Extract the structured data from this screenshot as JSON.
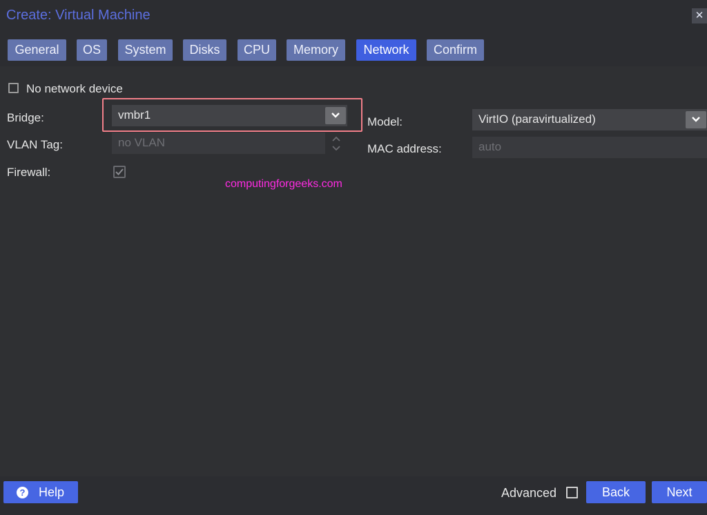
{
  "window": {
    "title": "Create: Virtual Machine",
    "close_glyph": "✕"
  },
  "tabs": [
    {
      "label": "General",
      "active": false
    },
    {
      "label": "OS",
      "active": false
    },
    {
      "label": "System",
      "active": false
    },
    {
      "label": "Disks",
      "active": false
    },
    {
      "label": "CPU",
      "active": false
    },
    {
      "label": "Memory",
      "active": false
    },
    {
      "label": "Network",
      "active": true
    },
    {
      "label": "Confirm",
      "active": false
    }
  ],
  "form": {
    "no_network_device": {
      "label": "No network device",
      "checked": false
    },
    "bridge": {
      "label": "Bridge:",
      "value": "vmbr1"
    },
    "vlan_tag": {
      "label": "VLAN Tag:",
      "placeholder": "no VLAN"
    },
    "firewall": {
      "label": "Firewall:",
      "checked": true
    },
    "model": {
      "label": "Model:",
      "value": "VirtIO (paravirtualized)"
    },
    "mac_address": {
      "label": "MAC address:",
      "placeholder": "auto"
    }
  },
  "watermark": "computingforgeeks.com",
  "footer": {
    "help_label": "Help",
    "help_icon_glyph": "?",
    "advanced_label": "Advanced",
    "advanced_checked": false,
    "back_label": "Back",
    "next_label": "Next"
  },
  "colors": {
    "accent": "#4766e3",
    "title": "#5c6fe0",
    "highlight_box": "#f17f89",
    "watermark": "#ff2be3"
  }
}
